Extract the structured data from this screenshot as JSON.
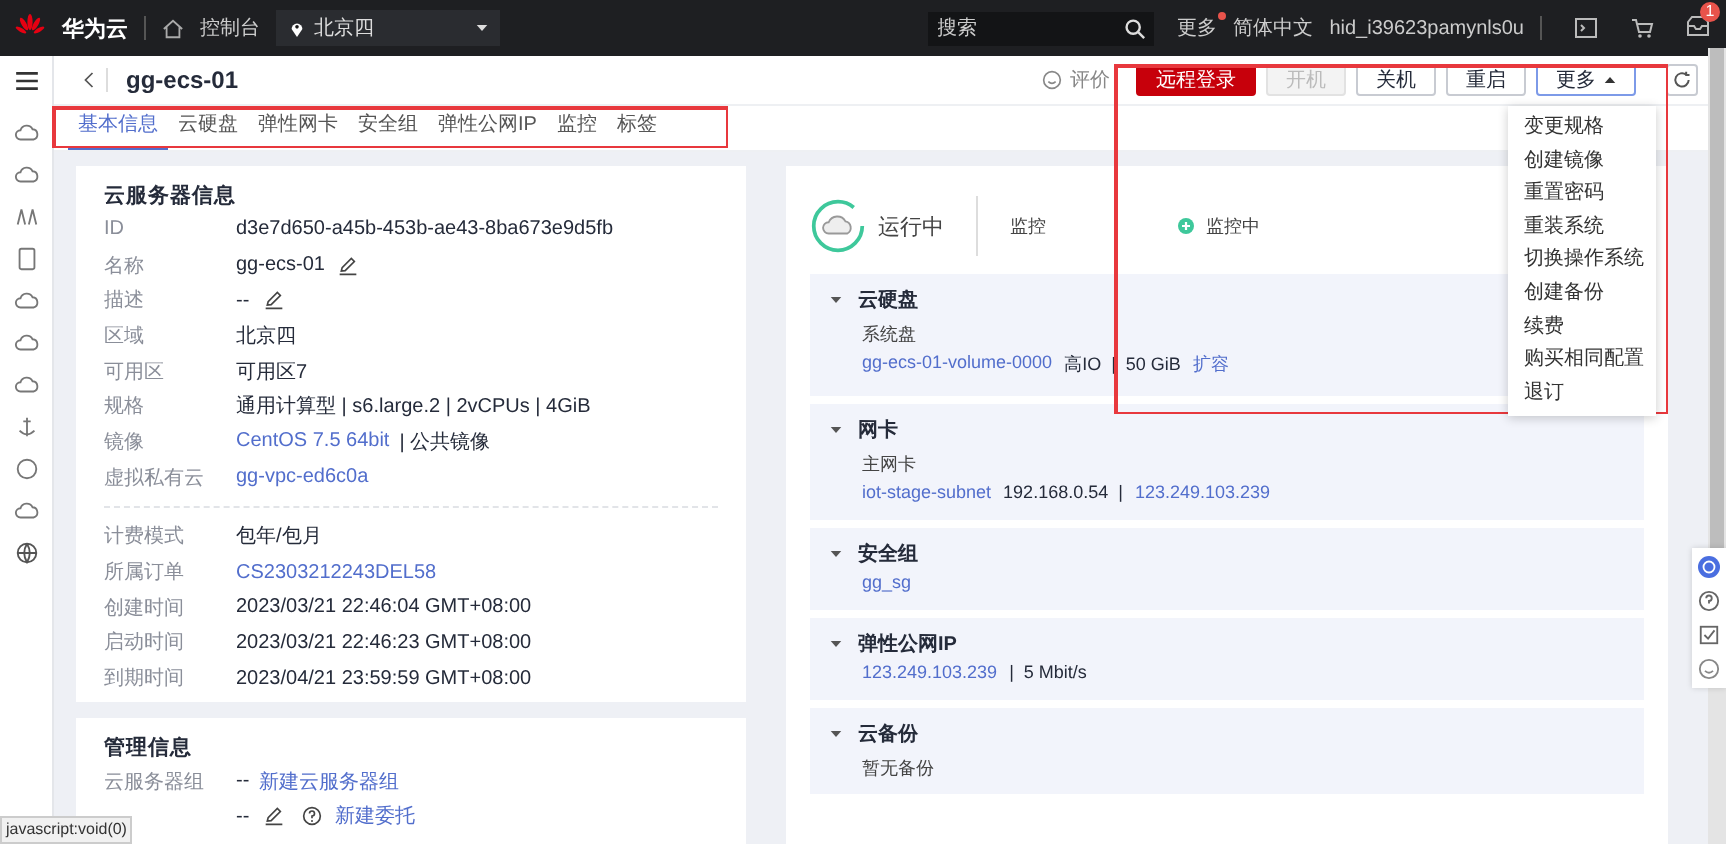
{
  "topbar": {
    "brand": "华为云",
    "console": "控制台",
    "region": "北京四",
    "search": {
      "placeholder": "搜索"
    },
    "more": {
      "label": "更多",
      "has_new": true
    },
    "language": "简体中文",
    "user": "hid_i39623pamynls0u",
    "inbox_badge": "1"
  },
  "page": {
    "title": "gg-ecs-01",
    "actions": [
      {
        "label": "评价",
        "kind": "rate"
      },
      {
        "label": "远程登录",
        "kind": "primary"
      },
      {
        "label": "开机",
        "kind": "plain",
        "disabled": true
      },
      {
        "label": "关机",
        "kind": "plain",
        "disabled": false
      },
      {
        "label": "重启",
        "kind": "plain",
        "disabled": false
      },
      {
        "label": "更多",
        "kind": "menu",
        "expanded": true
      }
    ],
    "menu": [
      "变更规格",
      "创建镜像",
      "重置密码",
      "重装系统",
      "切换操作系统",
      "创建备份",
      "续费",
      "购买相同配置",
      "退订"
    ]
  },
  "tabs": [
    {
      "label": "基本信息",
      "selected": true
    },
    {
      "label": "云硬盘",
      "selected": false
    },
    {
      "label": "弹性网卡",
      "selected": false
    },
    {
      "label": "安全组",
      "selected": false
    },
    {
      "label": "弹性公网IP",
      "selected": false
    },
    {
      "label": "监控",
      "selected": false
    },
    {
      "label": "标签",
      "selected": false
    }
  ],
  "server_info": {
    "title": "云服务器信息",
    "groups": [
      [
        {
          "label": "ID",
          "parts": [
            {
              "kind": "text",
              "text": "d3e7d650-a45b-453b-ae43-8ba673e9d5fb"
            }
          ]
        },
        {
          "label": "名称",
          "parts": [
            {
              "kind": "text",
              "text": "gg-ecs-01"
            },
            {
              "kind": "edit"
            }
          ]
        },
        {
          "label": "描述",
          "parts": [
            {
              "kind": "text",
              "text": "--"
            },
            {
              "kind": "edit"
            }
          ]
        },
        {
          "label": "区域",
          "parts": [
            {
              "kind": "text",
              "text": "北京四"
            }
          ]
        },
        {
          "label": "可用区",
          "parts": [
            {
              "kind": "text",
              "text": "可用区7"
            }
          ]
        },
        {
          "label": "规格",
          "parts": [
            {
              "kind": "text",
              "text": "通用计算型 | s6.large.2 | 2vCPUs | 4GiB"
            }
          ]
        },
        {
          "label": "镜像",
          "parts": [
            {
              "kind": "link",
              "text": "CentOS 7.5 64bit"
            },
            {
              "kind": "text",
              "text": "| 公共镜像"
            }
          ]
        },
        {
          "label": "虚拟私有云",
          "parts": [
            {
              "kind": "link",
              "text": "gg-vpc-ed6c0a"
            }
          ]
        }
      ],
      [
        {
          "label": "计费模式",
          "parts": [
            {
              "kind": "text",
              "text": "包年/包月"
            }
          ]
        },
        {
          "label": "所属订单",
          "parts": [
            {
              "kind": "link",
              "text": "CS2303212243DEL58"
            }
          ]
        },
        {
          "label": "创建时间",
          "parts": [
            {
              "kind": "text",
              "text": "2023/03/21 22:46:04 GMT+08:00"
            }
          ]
        },
        {
          "label": "启动时间",
          "parts": [
            {
              "kind": "text",
              "text": "2023/03/21 22:46:23 GMT+08:00"
            }
          ]
        },
        {
          "label": "到期时间",
          "parts": [
            {
              "kind": "text",
              "text": "2023/04/21 23:59:59 GMT+08:00"
            }
          ]
        }
      ]
    ]
  },
  "manage_info": {
    "title": "管理信息",
    "rows": [
      {
        "label": "云服务器组",
        "parts": [
          {
            "kind": "text",
            "text": "--"
          },
          {
            "kind": "link",
            "text": "新建云服务器组"
          }
        ]
      },
      {
        "parts": [
          {
            "kind": "text",
            "text": "--"
          },
          {
            "kind": "edit"
          },
          {
            "kind": "help"
          },
          {
            "kind": "link",
            "text": "新建委托"
          }
        ]
      }
    ]
  },
  "status": {
    "state": "运行中",
    "monitor_label": "监控",
    "monitor_status": "监控中"
  },
  "sections": [
    {
      "title": "云硬盘",
      "expanded": true,
      "sublabel": "系统盘",
      "parts": [
        {
          "kind": "link",
          "text": "gg-ecs-01-volume-0000"
        },
        {
          "kind": "text",
          "text": "高IO  |  50 GiB"
        },
        {
          "kind": "link",
          "text": "扩容"
        }
      ]
    },
    {
      "title": "网卡",
      "expanded": true,
      "sublabel": "主网卡",
      "parts": [
        {
          "kind": "link",
          "text": "iot-stage-subnet"
        },
        {
          "kind": "text",
          "text": "192.168.0.54  |"
        },
        {
          "kind": "link",
          "text": "123.249.103.239"
        }
      ]
    },
    {
      "title": "安全组",
      "expanded": true,
      "parts": [
        {
          "kind": "link",
          "text": "gg_sg"
        }
      ]
    },
    {
      "title": "弹性公网IP",
      "expanded": true,
      "parts": [
        {
          "kind": "link",
          "text": "123.249.103.239"
        },
        {
          "kind": "text",
          "text": "|  5 Mbit/s"
        }
      ]
    },
    {
      "title": "云备份",
      "expanded": true,
      "sublabel": "暂无备份"
    }
  ],
  "status_bar": "javascript:void(0)"
}
